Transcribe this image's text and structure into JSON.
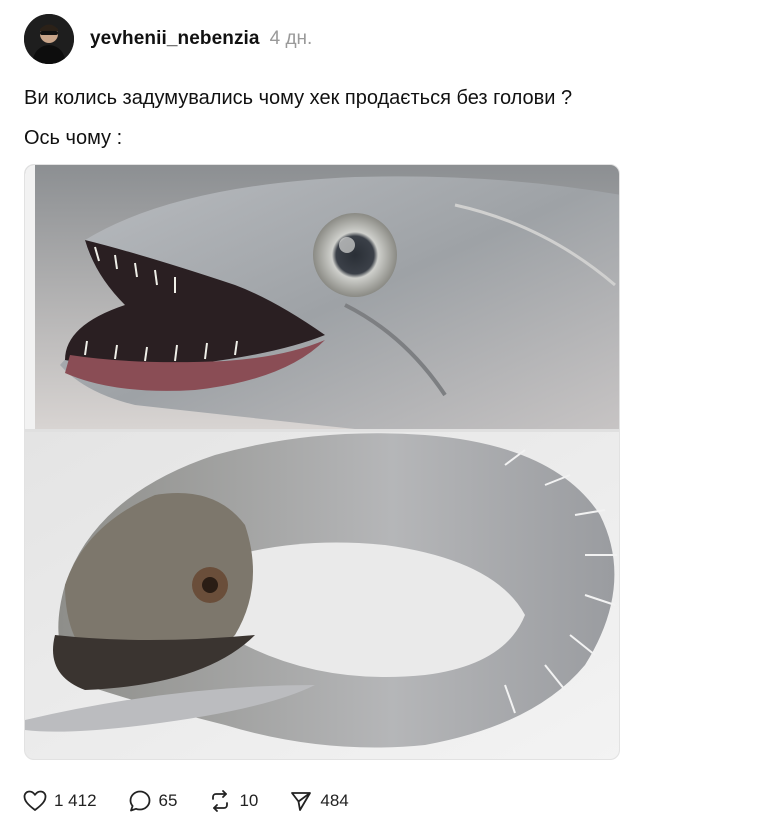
{
  "post": {
    "username": "yevhenii_nebenzia",
    "time_ago": "4 дн.",
    "text_line1": "Ви колись задумувались чому хек продається без голови ?",
    "text_line2": "Ось чому :",
    "media_icon": "photo"
  },
  "actions": {
    "likes": "1 412",
    "comments": "65",
    "reposts": "10",
    "shares": "484"
  },
  "icons": {
    "like": "heart-icon",
    "comment": "comment-bubble-icon",
    "repost": "repost-icon",
    "share": "send-icon"
  }
}
